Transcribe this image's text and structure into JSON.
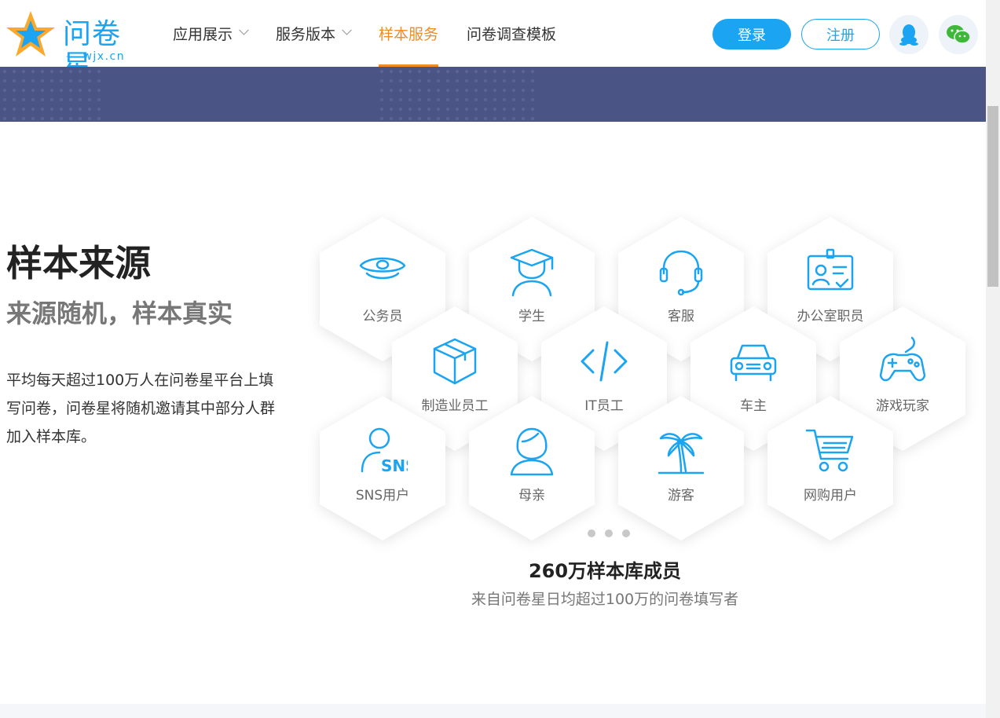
{
  "brand": {
    "name": "问卷星",
    "domain": "wjx.cn",
    "color": "#1aa4f1",
    "accent": "#f08c26"
  },
  "nav": {
    "items": [
      {
        "label": "应用展示",
        "has_dropdown": true,
        "active": false
      },
      {
        "label": "服务版本",
        "has_dropdown": true,
        "active": false
      },
      {
        "label": "样本服务",
        "has_dropdown": false,
        "active": true
      },
      {
        "label": "问卷调查模板",
        "has_dropdown": false,
        "active": false
      }
    ],
    "login": "登录",
    "register": "注册",
    "qq_icon": "qq-icon",
    "wechat_icon": "wechat-icon"
  },
  "section": {
    "title": "样本来源",
    "subtitle": "来源随机，样本真实",
    "description": "平均每天超过100万人在问卷星平台上填写问卷，问卷星将随机邀请其中部分人群加入样本库。"
  },
  "sample_groups": [
    {
      "label": "公务员",
      "icon": "officer-cap-icon"
    },
    {
      "label": "学生",
      "icon": "graduate-icon"
    },
    {
      "label": "客服",
      "icon": "headset-icon"
    },
    {
      "label": "办公室职员",
      "icon": "id-card-icon"
    },
    {
      "label": "制造业员工",
      "icon": "box-icon"
    },
    {
      "label": "IT员工",
      "icon": "code-icon"
    },
    {
      "label": "车主",
      "icon": "car-icon"
    },
    {
      "label": "游戏玩家",
      "icon": "gamepad-icon"
    },
    {
      "label": "SNS用户",
      "icon": "sns-user-icon"
    },
    {
      "label": "母亲",
      "icon": "mother-icon"
    },
    {
      "label": "游客",
      "icon": "palm-tree-icon"
    },
    {
      "label": "网购用户",
      "icon": "cart-icon"
    }
  ],
  "carousel": {
    "page_count": 3
  },
  "stat": {
    "title": "260万样本库成员",
    "subtitle": "来自问卷星日均超过100万的问卷填写者"
  }
}
